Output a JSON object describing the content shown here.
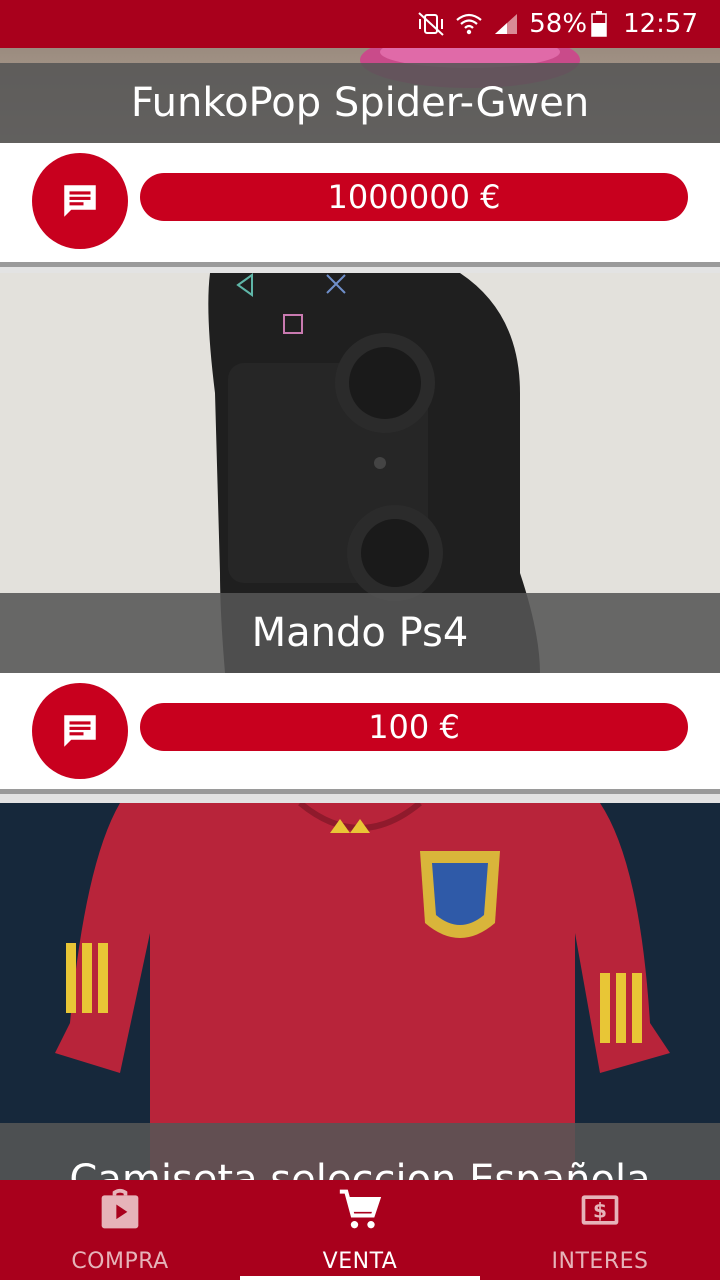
{
  "status_bar": {
    "battery": "58%",
    "time": "12:57"
  },
  "listings": [
    {
      "title": "FunkoPop Spider-Gwen",
      "price": "1000000 €"
    },
    {
      "title": "Mando Ps4",
      "price": "100 €"
    },
    {
      "title": "Camiseta seleccion Española"
    }
  ],
  "bottom_nav": {
    "items": [
      {
        "label": "COMPRA",
        "icon": "shopping-bag-play-icon"
      },
      {
        "label": "VENTA",
        "icon": "cart-icon"
      },
      {
        "label": "INTERES",
        "icon": "money-icon"
      }
    ],
    "active": "VENTA"
  },
  "colors": {
    "brand_dark": "#a9001c",
    "brand": "#c8001e",
    "overlay": "#555555"
  }
}
